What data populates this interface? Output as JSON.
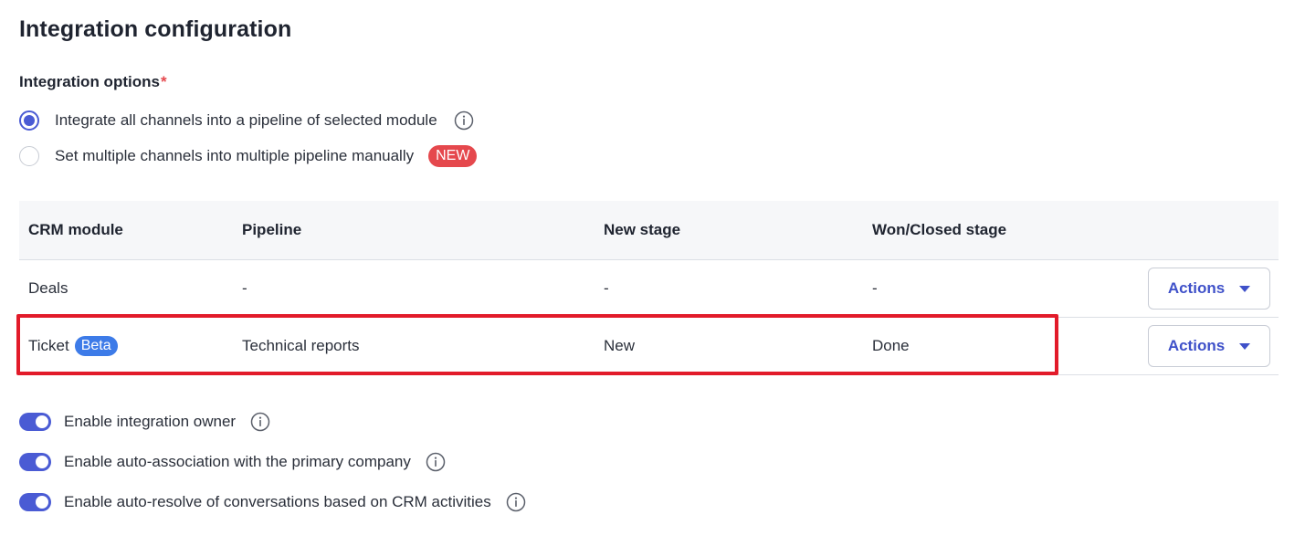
{
  "page": {
    "title": "Integration configuration"
  },
  "options": {
    "label": "Integration options",
    "required_mark": "*",
    "items": [
      {
        "label": "Integrate all channels into a pipeline of selected module",
        "selected": true,
        "info": true
      },
      {
        "label": "Set multiple channels into multiple pipeline manually",
        "selected": false,
        "badge": "NEW"
      }
    ]
  },
  "table": {
    "headers": [
      "CRM module",
      "Pipeline",
      "New stage",
      "Won/Closed stage"
    ],
    "rows": [
      {
        "module": "Deals",
        "badge": "",
        "pipeline": "-",
        "new_stage": "-",
        "won_stage": "-",
        "action": "Actions"
      },
      {
        "module": "Ticket",
        "badge": "Beta",
        "pipeline": "Technical reports",
        "new_stage": "New",
        "won_stage": "Done",
        "action": "Actions"
      }
    ]
  },
  "toggles": [
    {
      "label": "Enable integration owner",
      "on": true
    },
    {
      "label": "Enable auto-association with the primary company",
      "on": true
    },
    {
      "label": "Enable auto-resolve of conversations based on CRM activities",
      "on": true
    }
  ],
  "colors": {
    "accent": "#4a5bd4",
    "badge_new": "#e5484d",
    "badge_beta": "#3d7be8",
    "highlight": "#e21b2a"
  }
}
